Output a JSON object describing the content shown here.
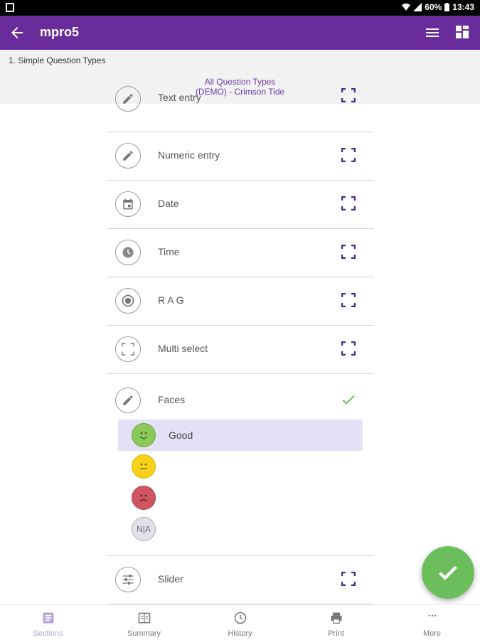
{
  "status_bar": {
    "battery": "60%",
    "time": "13:43"
  },
  "app_bar": {
    "title": "mpro5"
  },
  "section": {
    "title": "1. Simple Question Types",
    "subtitle_line1": "All Question Types",
    "subtitle_line2": "(DEMO) - Crimson Tide"
  },
  "questions": [
    {
      "label": "Text entry",
      "icon": "pencil-icon"
    },
    {
      "label": "Numeric entry",
      "icon": "pencil-icon"
    },
    {
      "label": "Date",
      "icon": "calendar-icon"
    },
    {
      "label": "Time",
      "icon": "clock-icon"
    },
    {
      "label": "R A G",
      "icon": "radio-target-icon"
    },
    {
      "label": "Multi select",
      "icon": "focus-frame-icon"
    }
  ],
  "faces_question": {
    "label": "Faces",
    "answered": true,
    "options": [
      {
        "label": "Good",
        "face": "happy",
        "selected": true
      },
      {
        "label": "",
        "face": "neutral",
        "selected": false
      },
      {
        "label": "",
        "face": "sad",
        "selected": false
      },
      {
        "label": "N|A",
        "face": "na",
        "selected": false
      }
    ]
  },
  "slider_question": {
    "label": "Slider",
    "icon": "sliders-icon"
  },
  "bottom_nav": [
    {
      "label": "Sections",
      "active": true
    },
    {
      "label": "Summary",
      "active": false
    },
    {
      "label": "History",
      "active": false
    },
    {
      "label": "Print",
      "active": false
    },
    {
      "label": "More",
      "active": false
    }
  ],
  "colors": {
    "primary": "#6a2c9a",
    "accent_green": "#6cbd5c",
    "selected_bg": "#e4e1f7"
  }
}
